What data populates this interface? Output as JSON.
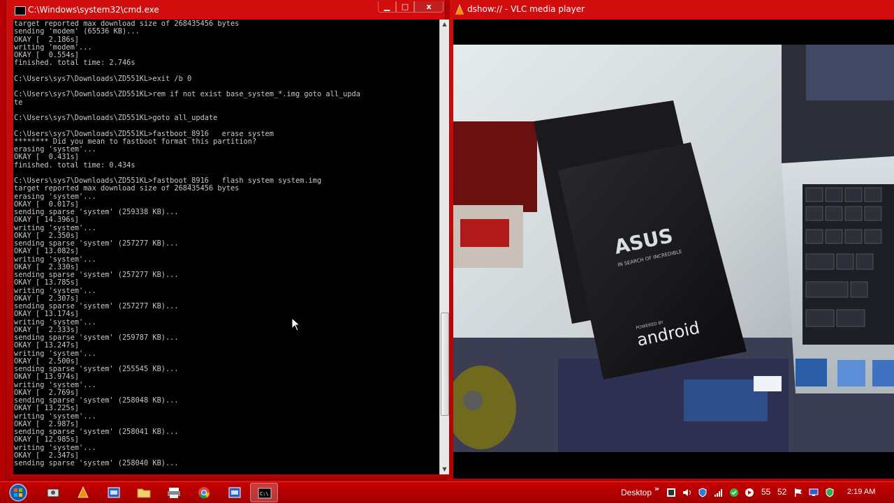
{
  "cmd": {
    "title": "C:\\Windows\\system32\\cmd.exe",
    "minimize_glyph": "▁",
    "maximize_glyph": "□",
    "close_glyph": "x",
    "console_lines": [
      "target reported max download size of 268435456 bytes",
      "sending 'modem' (65536 KB)...",
      "OKAY [  2.186s]",
      "writing 'modem'...",
      "OKAY [  0.554s]",
      "finished. total time: 2.746s",
      "",
      "C:\\Users\\sys7\\Downloads\\ZD551KL>exit /b 0",
      "",
      "C:\\Users\\sys7\\Downloads\\ZD551KL>rem if not exist base_system_*.img goto all_upda",
      "te",
      "",
      "C:\\Users\\sys7\\Downloads\\ZD551KL>goto all_update",
      "",
      "C:\\Users\\sys7\\Downloads\\ZD551KL>fastboot_8916   erase system",
      "******** Did you mean to fastboot format this partition?",
      "erasing 'system'...",
      "OKAY [  0.431s]",
      "finished. total time: 0.434s",
      "",
      "C:\\Users\\sys7\\Downloads\\ZD551KL>fastboot_8916   flash system system.img",
      "target reported max download size of 268435456 bytes",
      "erasing 'system'...",
      "OKAY [  0.017s]",
      "sending sparse 'system' (259338 KB)...",
      "OKAY [ 14.396s]",
      "writing 'system'...",
      "OKAY [  2.350s]",
      "sending sparse 'system' (257277 KB)...",
      "OKAY [ 13.082s]",
      "writing 'system'...",
      "OKAY [  2.330s]",
      "sending sparse 'system' (257277 KB)...",
      "OKAY [ 13.785s]",
      "writing 'system'...",
      "OKAY [  2.307s]",
      "sending sparse 'system' (257277 KB)...",
      "OKAY [ 13.174s]",
      "writing 'system'...",
      "OKAY [  2.333s]",
      "sending sparse 'system' (259787 KB)...",
      "OKAY [ 13.247s]",
      "writing 'system'...",
      "OKAY [  2.500s]",
      "sending sparse 'system' (255545 KB)...",
      "OKAY [ 13.974s]",
      "writing 'system'...",
      "OKAY [  2.769s]",
      "sending sparse 'system' (258048 KB)...",
      "OKAY [ 13.225s]",
      "writing 'system'...",
      "OKAY [  2.987s]",
      "sending sparse 'system' (258041 KB)...",
      "OKAY [ 12.985s]",
      "writing 'system'...",
      "OKAY [  2.347s]",
      "sending sparse 'system' (258040 KB)..."
    ]
  },
  "vlc": {
    "title": "dshow:// - VLC media player",
    "video_brand_text": "ASUS",
    "video_tagline": "IN SEARCH OF INCREDIBLE",
    "video_os_small": "POWERED BY",
    "video_os_text": "android"
  },
  "taskbar": {
    "pinned_icons": [
      "start-orb-icon",
      "device-manager-icon",
      "vlc-cone-icon",
      "window-app-icon",
      "folder-icon",
      "printer-icon",
      "chrome-icon",
      "window-app-icon",
      "cmd-icon"
    ],
    "desktop_label": "Desktop",
    "chevron": "»",
    "tray_num_1": "55",
    "tray_num_2": "52",
    "clock": "2:19 AM"
  },
  "colors": {
    "window_frame": "#c80000",
    "console_bg": "#000000",
    "console_fg": "#c8c8c8",
    "taskbar": "#b00000"
  }
}
